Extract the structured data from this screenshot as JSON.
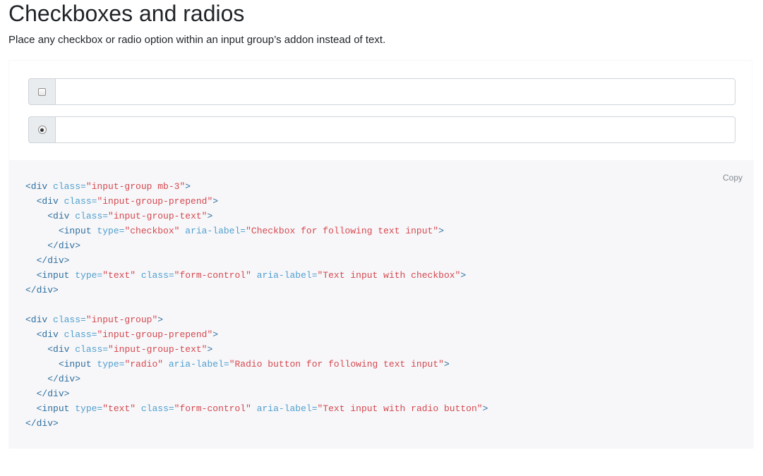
{
  "section": {
    "title": "Checkboxes and radios",
    "description": "Place any checkbox or radio option within an input group’s addon instead of text."
  },
  "example": {
    "checkbox_group": {
      "checked": false,
      "text_value": "",
      "aria_label": "Text input with checkbox"
    },
    "radio_group": {
      "checked": true,
      "text_value": "",
      "aria_label": "Text input with radio button"
    }
  },
  "code_block": {
    "copy_label": "Copy",
    "lines": [
      [
        [
          "tag",
          "<div "
        ],
        [
          "attr",
          "class="
        ],
        [
          "str",
          "\"input-group mb-3\""
        ],
        [
          "tag",
          ">"
        ]
      ],
      [
        [
          "text",
          "  "
        ],
        [
          "tag",
          "<div "
        ],
        [
          "attr",
          "class="
        ],
        [
          "str",
          "\"input-group-prepend\""
        ],
        [
          "tag",
          ">"
        ]
      ],
      [
        [
          "text",
          "    "
        ],
        [
          "tag",
          "<div "
        ],
        [
          "attr",
          "class="
        ],
        [
          "str",
          "\"input-group-text\""
        ],
        [
          "tag",
          ">"
        ]
      ],
      [
        [
          "text",
          "      "
        ],
        [
          "tag",
          "<input "
        ],
        [
          "attr",
          "type="
        ],
        [
          "str",
          "\"checkbox\""
        ],
        [
          "text",
          " "
        ],
        [
          "attr",
          "aria-label="
        ],
        [
          "str",
          "\"Checkbox for following text input\""
        ],
        [
          "tag",
          ">"
        ]
      ],
      [
        [
          "text",
          "    "
        ],
        [
          "tag",
          "</div>"
        ]
      ],
      [
        [
          "text",
          "  "
        ],
        [
          "tag",
          "</div>"
        ]
      ],
      [
        [
          "text",
          "  "
        ],
        [
          "tag",
          "<input "
        ],
        [
          "attr",
          "type="
        ],
        [
          "str",
          "\"text\""
        ],
        [
          "text",
          " "
        ],
        [
          "attr",
          "class="
        ],
        [
          "str",
          "\"form-control\""
        ],
        [
          "text",
          " "
        ],
        [
          "attr",
          "aria-label="
        ],
        [
          "str",
          "\"Text input with checkbox\""
        ],
        [
          "tag",
          ">"
        ]
      ],
      [
        [
          "tag",
          "</div>"
        ]
      ],
      [],
      [
        [
          "tag",
          "<div "
        ],
        [
          "attr",
          "class="
        ],
        [
          "str",
          "\"input-group\""
        ],
        [
          "tag",
          ">"
        ]
      ],
      [
        [
          "text",
          "  "
        ],
        [
          "tag",
          "<div "
        ],
        [
          "attr",
          "class="
        ],
        [
          "str",
          "\"input-group-prepend\""
        ],
        [
          "tag",
          ">"
        ]
      ],
      [
        [
          "text",
          "    "
        ],
        [
          "tag",
          "<div "
        ],
        [
          "attr",
          "class="
        ],
        [
          "str",
          "\"input-group-text\""
        ],
        [
          "tag",
          ">"
        ]
      ],
      [
        [
          "text",
          "      "
        ],
        [
          "tag",
          "<input "
        ],
        [
          "attr",
          "type="
        ],
        [
          "str",
          "\"radio\""
        ],
        [
          "text",
          " "
        ],
        [
          "attr",
          "aria-label="
        ],
        [
          "str",
          "\"Radio button for following text input\""
        ],
        [
          "tag",
          ">"
        ]
      ],
      [
        [
          "text",
          "    "
        ],
        [
          "tag",
          "</div>"
        ]
      ],
      [
        [
          "text",
          "  "
        ],
        [
          "tag",
          "</div>"
        ]
      ],
      [
        [
          "text",
          "  "
        ],
        [
          "tag",
          "<input "
        ],
        [
          "attr",
          "type="
        ],
        [
          "str",
          "\"text\""
        ],
        [
          "text",
          " "
        ],
        [
          "attr",
          "class="
        ],
        [
          "str",
          "\"form-control\""
        ],
        [
          "text",
          " "
        ],
        [
          "attr",
          "aria-label="
        ],
        [
          "str",
          "\"Text input with radio button\""
        ],
        [
          "tag",
          ">"
        ]
      ],
      [
        [
          "tag",
          "</div>"
        ]
      ]
    ]
  }
}
